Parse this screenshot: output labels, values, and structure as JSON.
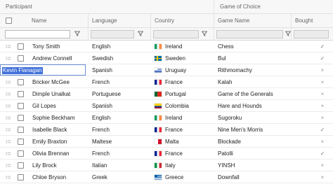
{
  "groups": {
    "participant": "Participant",
    "game_of_choice": "Game of Choice"
  },
  "columns": {
    "name": "Name",
    "language": "Language",
    "country": "Country",
    "game_name": "Game Name",
    "bought": "Bought"
  },
  "filter": {
    "icon": "funnel-icon"
  },
  "editing": {
    "row_index": 2,
    "value": "Kevin Flanagan"
  },
  "rows": [
    {
      "name": "Tony Smith",
      "language": "English",
      "country": "Ireland",
      "flag": "ireland",
      "game": "Chess",
      "bought": "✓"
    },
    {
      "name": "Andrew Connell",
      "language": "Swedish",
      "country": "Sweden",
      "flag": "sweden",
      "game": "Bul",
      "bought": "✓"
    },
    {
      "name": "Kevin Flanagan",
      "language": "Spanish",
      "country": "Uruguay",
      "flag": "uruguay",
      "game": "Rithmomachy",
      "bought": "×"
    },
    {
      "name": "Bricker McGee",
      "language": "French",
      "country": "France",
      "flag": "france",
      "game": "Kalah",
      "bought": "×"
    },
    {
      "name": "Dimple Unalkat",
      "language": "Portuguese",
      "country": "Portugal",
      "flag": "portugal",
      "game": "Game of the Generals",
      "bought": "×"
    },
    {
      "name": "Gil Lopes",
      "language": "Spanish",
      "country": "Colombia",
      "flag": "colombia",
      "game": "Hare and Hounds",
      "bought": "×"
    },
    {
      "name": "Sophie Beckham",
      "language": "English",
      "country": "Ireland",
      "flag": "ireland",
      "game": "Sugoroku",
      "bought": "×"
    },
    {
      "name": "Isabelle Black",
      "language": "French",
      "country": "France",
      "flag": "france",
      "game": "Nine Men's Morris",
      "bought": "✓"
    },
    {
      "name": "Emily Braxton",
      "language": "Maltese",
      "country": "Malta",
      "flag": "malta",
      "game": "Blockade",
      "bought": "×"
    },
    {
      "name": "Olivia Brennan",
      "language": "French",
      "country": "France",
      "flag": "france",
      "game": "Patolli",
      "bought": "✓"
    },
    {
      "name": "Lily Brock",
      "language": "Italian",
      "country": "Italy",
      "flag": "italy",
      "game": "YINSH",
      "bought": "×"
    },
    {
      "name": "Chloe Bryson",
      "language": "Greek",
      "country": "Greece",
      "flag": "greece",
      "game": "Downfall",
      "bought": "×"
    }
  ]
}
